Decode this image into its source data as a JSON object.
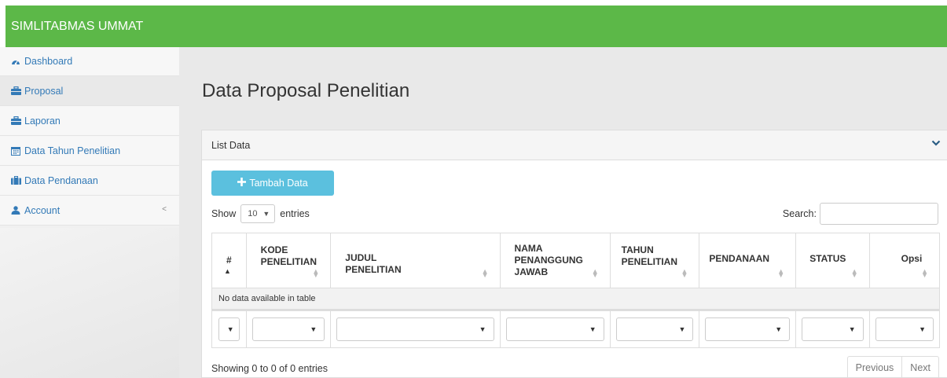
{
  "app": {
    "title": "SIMLITABMAS UMMAT",
    "accent": "#5cb848"
  },
  "sidebar": {
    "items": [
      {
        "label": "Dashboard",
        "icon": "dashboard-icon"
      },
      {
        "label": "Proposal",
        "icon": "briefcase-icon"
      },
      {
        "label": "Laporan",
        "icon": "briefcase-icon"
      },
      {
        "label": "Data Tahun Penelitian",
        "icon": "calendar-icon"
      },
      {
        "label": "Data Pendanaan",
        "icon": "suitcase-icon"
      },
      {
        "label": "Account",
        "icon": "user-icon",
        "caret": "<"
      }
    ],
    "active_index": 1
  },
  "page": {
    "title": "Data Proposal Penelitian"
  },
  "panel": {
    "title": "List Data",
    "collapse_icon": "chevron-down-icon"
  },
  "toolbar": {
    "add_label": "Tambah Data"
  },
  "length": {
    "show_label": "Show",
    "value": "10",
    "entries_label": "entries"
  },
  "search": {
    "label": "Search:",
    "value": ""
  },
  "table": {
    "headers": [
      {
        "l1": "#",
        "l2": "",
        "l3": ""
      },
      {
        "l1": "KODE",
        "l2": "PENELITIAN",
        "l3": ""
      },
      {
        "l1": "JUDUL",
        "l2": "PENELITIAN",
        "l3": ""
      },
      {
        "l1": "NAMA",
        "l2": "PENANGGUNG",
        "l3": "JAWAB"
      },
      {
        "l1": "TAHUN",
        "l2": "PENELITIAN",
        "l3": ""
      },
      {
        "l1": "PENDANAAN",
        "l2": "",
        "l3": ""
      },
      {
        "l1": "STATUS",
        "l2": "",
        "l3": ""
      },
      {
        "l1": "Opsi",
        "l2": "",
        "l3": ""
      }
    ],
    "empty_message": "No data available in table"
  },
  "footer": {
    "info": "Showing 0 to 0 of 0 entries",
    "prev_label": "Previous",
    "next_label": "Next"
  }
}
